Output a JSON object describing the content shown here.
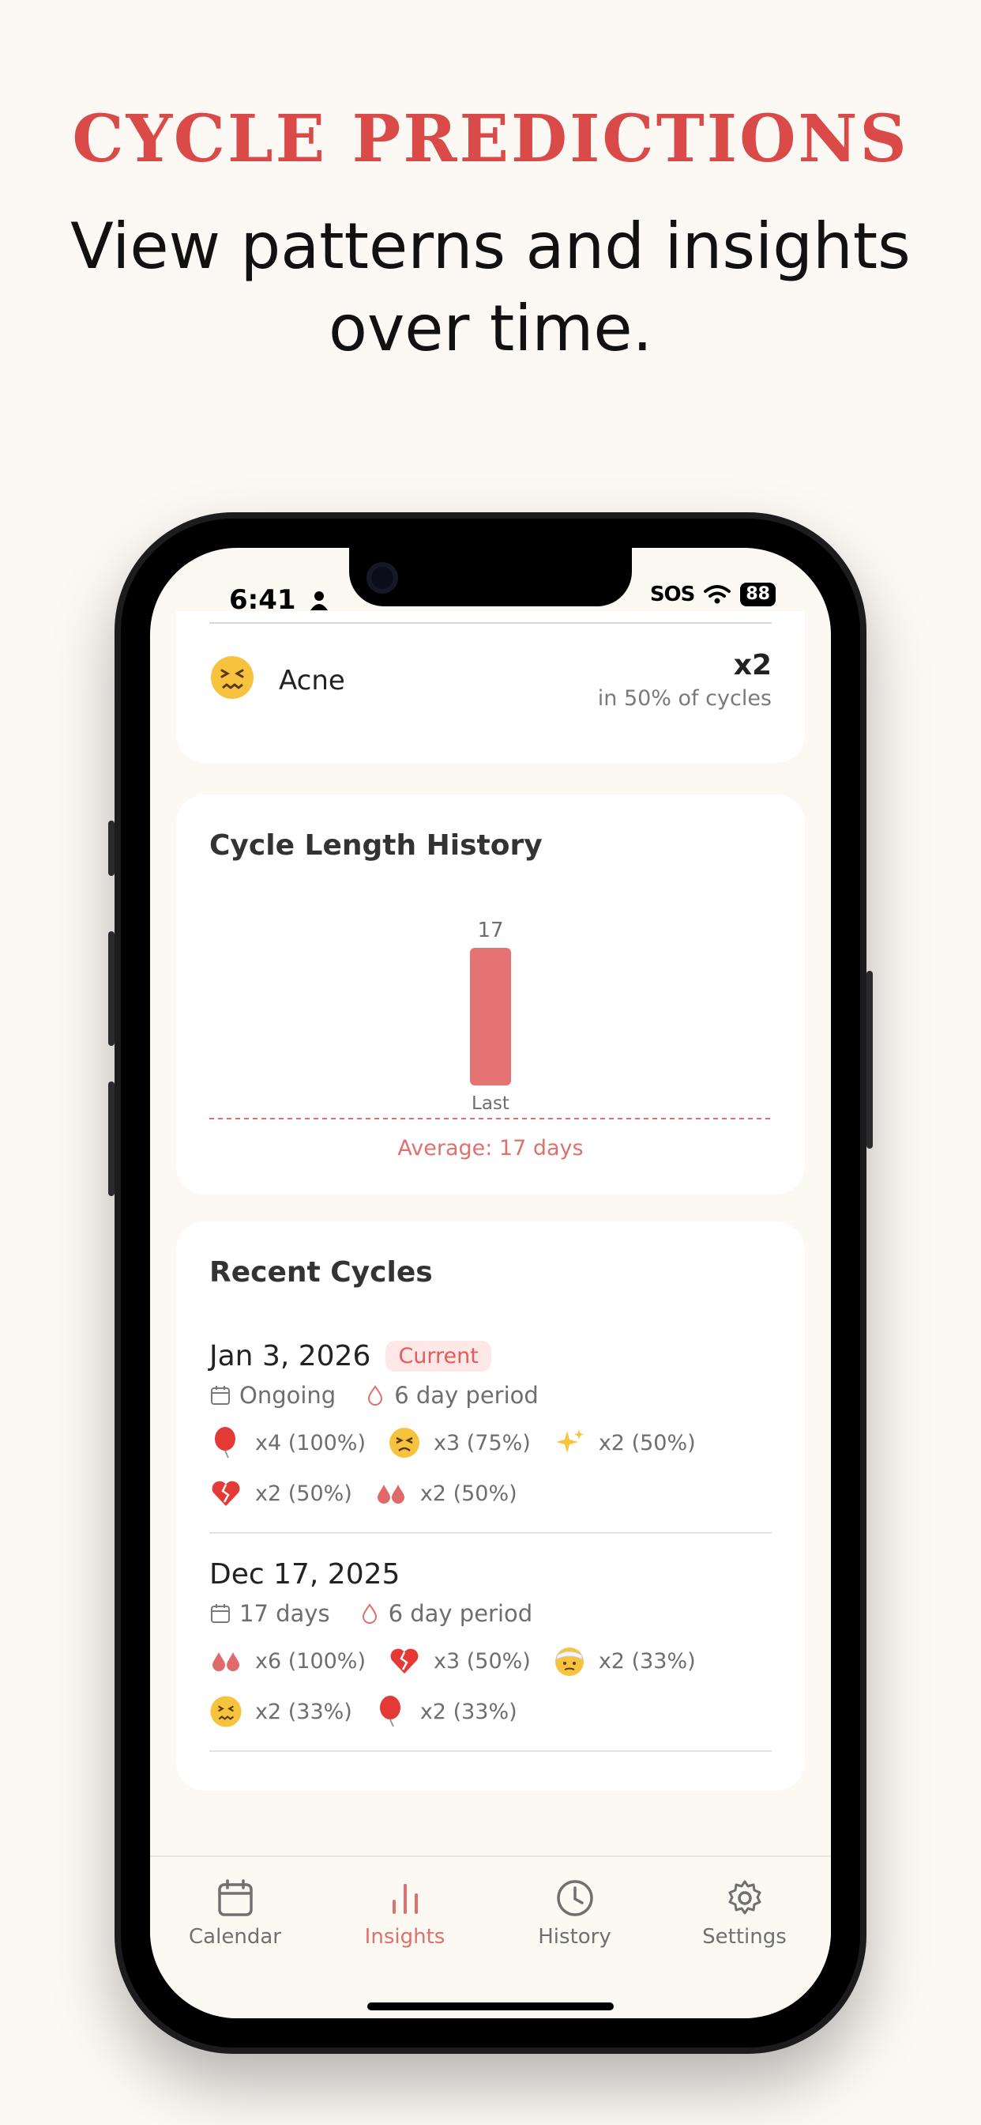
{
  "hero": {
    "eyebrow": "CYCLE PREDICTIONS",
    "title": "View patterns and insights over time."
  },
  "status_bar": {
    "time": "6:41",
    "sos": "SOS",
    "battery": "88"
  },
  "symptom_row": {
    "icon": "confounded-face-emoji",
    "label": "Acne",
    "count": "x2",
    "subtitle": "in 50% of cycles"
  },
  "cycle_length_card": {
    "title": "Cycle Length History",
    "average_label": "Average: 17 days",
    "chart_data": {
      "type": "bar",
      "categories": [
        "Last"
      ],
      "values": [
        17
      ],
      "data_labels": [
        "17"
      ],
      "average": 17,
      "ylim": [
        0,
        17
      ],
      "colors": {
        "bar": "#e57373",
        "average_line": "#e0706d"
      }
    }
  },
  "recent_cycles": {
    "title": "Recent Cycles",
    "cycles": [
      {
        "date": "Jan 3, 2026",
        "badge": "Current",
        "length": "Ongoing",
        "period": "6 day period",
        "symptoms": [
          {
            "icon": "balloon-emoji",
            "text": "x4 (100%)"
          },
          {
            "icon": "persevering-face-emoji",
            "text": "x3 (75%)"
          },
          {
            "icon": "sparkles-emoji",
            "text": "x2 (50%)"
          },
          {
            "icon": "broken-heart-emoji",
            "text": "x2 (50%)"
          },
          {
            "icon": "drops-emoji",
            "text": "x2 (50%)"
          }
        ]
      },
      {
        "date": "Dec 17, 2025",
        "badge": "",
        "length": "17 days",
        "period": "6 day period",
        "symptoms": [
          {
            "icon": "drops-emoji",
            "text": "x6 (100%)"
          },
          {
            "icon": "broken-heart-emoji",
            "text": "x3 (50%)"
          },
          {
            "icon": "bandaged-head-emoji",
            "text": "x2 (33%)"
          },
          {
            "icon": "confounded-face-emoji",
            "text": "x2 (33%)"
          },
          {
            "icon": "balloon-emoji",
            "text": "x2 (33%)"
          }
        ]
      }
    ]
  },
  "tabbar": {
    "tabs": [
      {
        "label": "Calendar",
        "icon": "calendar-icon",
        "active": false
      },
      {
        "label": "Insights",
        "icon": "bar-chart-icon",
        "active": true
      },
      {
        "label": "History",
        "icon": "clock-icon",
        "active": false
      },
      {
        "label": "Settings",
        "icon": "gear-icon",
        "active": false
      }
    ]
  },
  "colors": {
    "accent": "#d94a48",
    "chart_red": "#e57373",
    "background": "#fcf9f4"
  }
}
